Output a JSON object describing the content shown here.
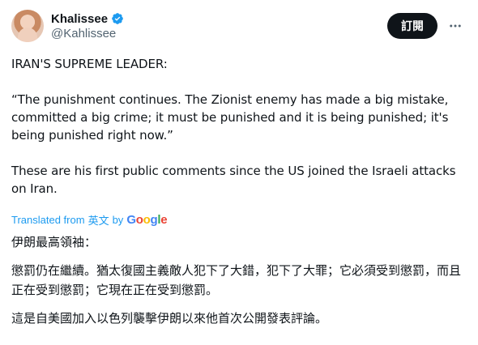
{
  "author": {
    "name": "Khalissee",
    "handle": "@Kahlissee",
    "verified_color": "#1d9bf0"
  },
  "header": {
    "subscribe_label": "訂閱",
    "more_label": "···"
  },
  "tweet": {
    "line1": "IRAN'S SUPREME LEADER:",
    "quote": "“The punishment continues. The Zionist enemy has made a big mistake, committed a big crime; it must be punished and it is being punished; it's being punished right now.”",
    "context": "These are his first public comments since the US joined the Israeli attacks on Iran."
  },
  "translation": {
    "label": "Translated from",
    "language": "英文",
    "by": "by",
    "google_letters": [
      "G",
      "o",
      "o",
      "g",
      "l",
      "e"
    ]
  },
  "translated_text": {
    "line1": "伊朗最高領袖：",
    "quote": "懲罰仍在繼續。猶太復國主義敵人犯下了大錯，犯下了大罪；它必須受到懲罰，而且正在受到懲罰；它現在正在受到懲罰。",
    "context": "這是自美國加入以色列襲擊伊朗以來他首次公開發表評論。"
  },
  "icons": [
    "verified-badge-icon",
    "more-icon",
    "google-logo"
  ]
}
